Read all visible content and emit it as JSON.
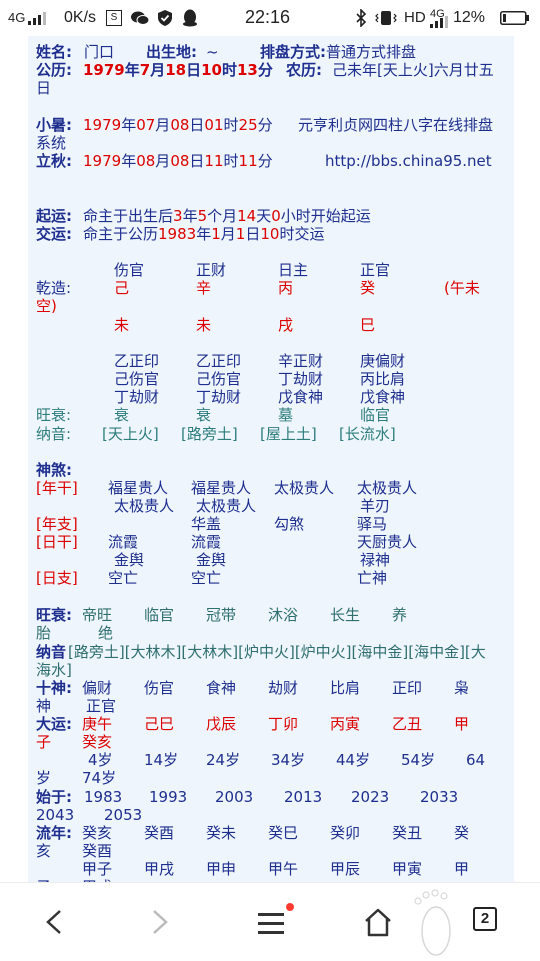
{
  "status_bar": {
    "network": "4G",
    "speed": "0K/s",
    "s_label": "S",
    "time": "22:16",
    "hd": "HD",
    "network2": "4G",
    "battery": "12%"
  },
  "page": {
    "name_label": "姓名:",
    "name_value": "门口",
    "birthplace_label": "出生地:",
    "birthplace_value": "~",
    "method_label": "排盘方式:",
    "method_value": "普通方式排盘",
    "gongli_label": "公历:",
    "gongli_y": "1979",
    "gongli_yc": "年",
    "gongli_m": "7",
    "gongli_mc": "月",
    "gongli_d": "18",
    "gongli_dc": "日",
    "gongli_h": "10",
    "gongli_hc": "时",
    "gongli_min": "13",
    "gongli_minc": "分",
    "nongli_label": "农历:",
    "nongli_value": "己未年[天上火]六月廿五",
    "nongli_wrap": "日",
    "xiaoshu_label": "小暑:",
    "xiaoshu": [
      "1979",
      "年",
      "07",
      "月",
      "08",
      "日",
      "01",
      "时",
      "25",
      "分"
    ],
    "xiaoshu_note": "元亨利贞网四柱八字在线排盘",
    "xiaoshu_note_wrap": "系统",
    "liqiu_label": "立秋:",
    "liqiu": [
      "1979",
      "年",
      "08",
      "月",
      "08",
      "日",
      "11",
      "时",
      "11",
      "分"
    ],
    "url": "http://bbs.china95.net",
    "qiyun_label": "起运:",
    "qiyun": [
      "命主于出生后",
      "3",
      "年",
      "5",
      "个月",
      "14",
      "天",
      "0",
      "小时开始起运"
    ],
    "jiaoyun_label": "交运:",
    "jiaoyun": [
      "命主于公历",
      "1983",
      "年",
      "1",
      "月",
      "1",
      "日",
      "10",
      "时交运"
    ],
    "ten_gods_top": [
      "伤官",
      "正财",
      "日主",
      "正官"
    ],
    "qianzao_label": "乾造:",
    "stems": [
      "己",
      "辛",
      "丙",
      "癸"
    ],
    "kong": "(午未",
    "kong_wrap": "空)",
    "branches": [
      "未",
      "未",
      "戌",
      "巳"
    ],
    "hidden_row1": [
      "乙正印",
      "乙正印",
      "辛正财",
      "庚偏财"
    ],
    "hidden_row2": [
      "己伤官",
      "己伤官",
      "丁劫财",
      "丙比肩"
    ],
    "hidden_row3": [
      "丁劫财",
      "丁劫财",
      "戊食神",
      "戊食神"
    ],
    "wangshuai_label": "旺衰:",
    "wangshuai": [
      "衰",
      "衰",
      "墓",
      "临官"
    ],
    "nayin_label": "纳音:",
    "nayin": [
      "[天上火]",
      "[路旁土]",
      "[屋上土]",
      "[长流水]"
    ],
    "shensha_label": "神煞:",
    "nian_gan_label": "[年干]",
    "ss_row1": [
      "福星贵人",
      "福星贵人",
      "太极贵人",
      "太极贵人"
    ],
    "ss_row2": [
      "太极贵人",
      "太极贵人",
      "羊刃"
    ],
    "nian_zhi_label": "[年支]",
    "ss_row3": [
      "华盖",
      "勾煞",
      "驿马"
    ],
    "ri_gan_label": "[日干]",
    "ss_row4": [
      "流霞",
      "流霞",
      "天厨贵人"
    ],
    "ss_row5": [
      "金舆",
      "金舆",
      "禄神"
    ],
    "ri_zhi_label": "[日支]",
    "ss_row6": [
      "空亡",
      "空亡",
      "亡神"
    ],
    "ws2_label": "旺衰:",
    "ws2": [
      "帝旺",
      "临官",
      "冠带",
      "沐浴",
      "长生",
      "养"
    ],
    "ws2_wrap": [
      "胎",
      "绝"
    ],
    "nayin2_label": "纳音",
    "nayin2": "[路旁土][大林木][大林木][炉中火][炉中火][海中金][海中金][大",
    "nayin2_wrap": "海水]",
    "shishen_label": "十神:",
    "shishen": [
      "偏财",
      "伤官",
      "食神",
      "劫财",
      "比肩",
      "正印",
      "枭"
    ],
    "shishen_wrap": [
      "神",
      "正官"
    ],
    "dayun_label": "大运:",
    "dayun": [
      "庚午",
      "己巳",
      "戊辰",
      "丁卯",
      "丙寅",
      "乙丑",
      "甲"
    ],
    "dayun_wrap": [
      "子",
      "癸亥"
    ],
    "ages": [
      "4岁",
      "14岁",
      "24岁",
      "34岁",
      "44岁",
      "54岁",
      "64"
    ],
    "ages_wrap": [
      "岁",
      "74岁"
    ],
    "shiyu_label": "始于:",
    "shiyu": [
      "1983",
      "1993",
      "2003",
      "2013",
      "2023",
      "2033"
    ],
    "shiyu_wrap": [
      "2043",
      "2053"
    ],
    "liunian_label": "流年:",
    "liunian": [
      "癸亥",
      "癸酉",
      "癸未",
      "癸巳",
      "癸卯",
      "癸丑",
      "癸"
    ],
    "liunian_wrap": [
      "亥",
      "癸酉"
    ],
    "liunian2": [
      "甲子",
      "甲戌",
      "甲申",
      "甲午",
      "甲辰",
      "甲寅",
      "甲"
    ],
    "liunian2_wrap": [
      "子",
      "甲戌"
    ]
  },
  "nav": {
    "tab_count": "2"
  },
  "colors": {
    "accent_red": "#dd0000",
    "label_blue": "#1f2f8f",
    "teal": "#2d7d7d",
    "panel_bg": "#eef5fc"
  }
}
